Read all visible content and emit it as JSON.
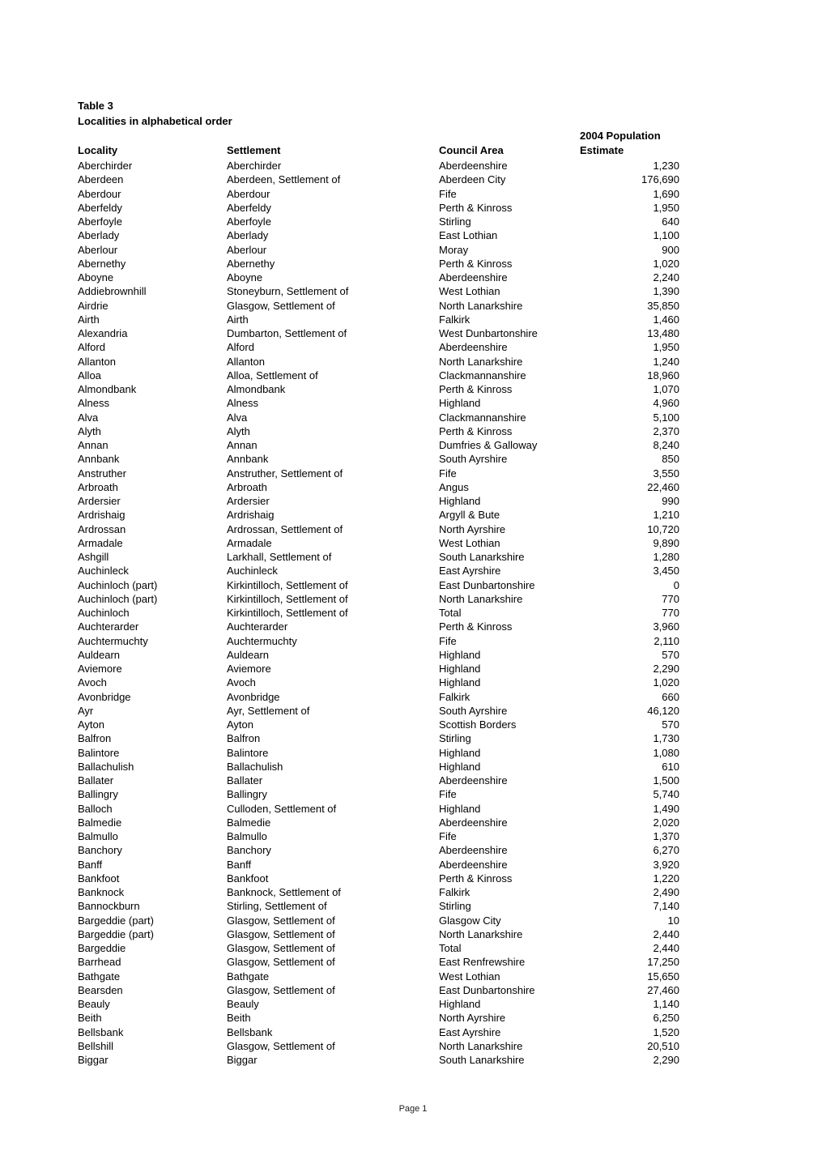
{
  "document": {
    "title": "Table 3",
    "subtitle": "Localities in alphabetical order",
    "columns": {
      "locality": "Locality",
      "settlement": "Settlement",
      "council_area": "Council Area",
      "population_line1": "2004 Population",
      "population_line2": "Estimate"
    },
    "rows": [
      [
        "Aberchirder",
        "Aberchirder",
        "Aberdeenshire",
        "1,230"
      ],
      [
        "Aberdeen",
        "Aberdeen, Settlement of",
        "Aberdeen City",
        "176,690"
      ],
      [
        "Aberdour",
        "Aberdour",
        "Fife",
        "1,690"
      ],
      [
        "Aberfeldy",
        "Aberfeldy",
        "Perth & Kinross",
        "1,950"
      ],
      [
        "Aberfoyle",
        "Aberfoyle",
        "Stirling",
        "640"
      ],
      [
        "Aberlady",
        "Aberlady",
        "East Lothian",
        "1,100"
      ],
      [
        "Aberlour",
        "Aberlour",
        "Moray",
        "900"
      ],
      [
        "Abernethy",
        "Abernethy",
        "Perth & Kinross",
        "1,020"
      ],
      [
        "Aboyne",
        "Aboyne",
        "Aberdeenshire",
        "2,240"
      ],
      [
        "Addiebrownhill",
        "Stoneyburn, Settlement of",
        "West Lothian",
        "1,390"
      ],
      [
        "Airdrie",
        "Glasgow, Settlement of",
        "North Lanarkshire",
        "35,850"
      ],
      [
        "Airth",
        "Airth",
        "Falkirk",
        "1,460"
      ],
      [
        "Alexandria",
        "Dumbarton, Settlement of",
        "West Dunbartonshire",
        "13,480"
      ],
      [
        "Alford",
        "Alford",
        "Aberdeenshire",
        "1,950"
      ],
      [
        "Allanton",
        "Allanton",
        "North Lanarkshire",
        "1,240"
      ],
      [
        "Alloa",
        "Alloa, Settlement of",
        "Clackmannanshire",
        "18,960"
      ],
      [
        "Almondbank",
        "Almondbank",
        "Perth & Kinross",
        "1,070"
      ],
      [
        "Alness",
        "Alness",
        "Highland",
        "4,960"
      ],
      [
        "Alva",
        "Alva",
        "Clackmannanshire",
        "5,100"
      ],
      [
        "Alyth",
        "Alyth",
        "Perth & Kinross",
        "2,370"
      ],
      [
        "Annan",
        "Annan",
        "Dumfries & Galloway",
        "8,240"
      ],
      [
        "Annbank",
        "Annbank",
        "South Ayrshire",
        "850"
      ],
      [
        "Anstruther",
        "Anstruther, Settlement of",
        "Fife",
        "3,550"
      ],
      [
        "Arbroath",
        "Arbroath",
        "Angus",
        "22,460"
      ],
      [
        "Ardersier",
        "Ardersier",
        "Highland",
        "990"
      ],
      [
        "Ardrishaig",
        "Ardrishaig",
        "Argyll & Bute",
        "1,210"
      ],
      [
        "Ardrossan",
        "Ardrossan, Settlement of",
        "North Ayrshire",
        "10,720"
      ],
      [
        "Armadale",
        "Armadale",
        "West Lothian",
        "9,890"
      ],
      [
        "Ashgill",
        "Larkhall, Settlement of",
        "South Lanarkshire",
        "1,280"
      ],
      [
        "Auchinleck",
        "Auchinleck",
        "East Ayrshire",
        "3,450"
      ],
      [
        "Auchinloch (part)",
        "Kirkintilloch, Settlement of",
        "East Dunbartonshire",
        "0"
      ],
      [
        "Auchinloch (part)",
        "Kirkintilloch, Settlement of",
        "North Lanarkshire",
        "770"
      ],
      [
        "Auchinloch",
        "Kirkintilloch, Settlement of",
        "Total",
        "770"
      ],
      [
        "Auchterarder",
        "Auchterarder",
        "Perth & Kinross",
        "3,960"
      ],
      [
        "Auchtermuchty",
        "Auchtermuchty",
        "Fife",
        "2,110"
      ],
      [
        "Auldearn",
        "Auldearn",
        "Highland",
        "570"
      ],
      [
        "Aviemore",
        "Aviemore",
        "Highland",
        "2,290"
      ],
      [
        "Avoch",
        "Avoch",
        "Highland",
        "1,020"
      ],
      [
        "Avonbridge",
        "Avonbridge",
        "Falkirk",
        "660"
      ],
      [
        "Ayr",
        "Ayr, Settlement of",
        "South Ayrshire",
        "46,120"
      ],
      [
        "Ayton",
        "Ayton",
        "Scottish Borders",
        "570"
      ],
      [
        "Balfron",
        "Balfron",
        "Stirling",
        "1,730"
      ],
      [
        "Balintore",
        "Balintore",
        "Highland",
        "1,080"
      ],
      [
        "Ballachulish",
        "Ballachulish",
        "Highland",
        "610"
      ],
      [
        "Ballater",
        "Ballater",
        "Aberdeenshire",
        "1,500"
      ],
      [
        "Ballingry",
        "Ballingry",
        "Fife",
        "5,740"
      ],
      [
        "Balloch",
        "Culloden, Settlement of",
        "Highland",
        "1,490"
      ],
      [
        "Balmedie",
        "Balmedie",
        "Aberdeenshire",
        "2,020"
      ],
      [
        "Balmullo",
        "Balmullo",
        "Fife",
        "1,370"
      ],
      [
        "Banchory",
        "Banchory",
        "Aberdeenshire",
        "6,270"
      ],
      [
        "Banff",
        "Banff",
        "Aberdeenshire",
        "3,920"
      ],
      [
        "Bankfoot",
        "Bankfoot",
        "Perth & Kinross",
        "1,220"
      ],
      [
        "Banknock",
        "Banknock, Settlement of",
        "Falkirk",
        "2,490"
      ],
      [
        "Bannockburn",
        "Stirling, Settlement of",
        "Stirling",
        "7,140"
      ],
      [
        "Bargeddie (part)",
        "Glasgow, Settlement of",
        "Glasgow City",
        "10"
      ],
      [
        "Bargeddie (part)",
        "Glasgow, Settlement of",
        "North Lanarkshire",
        "2,440"
      ],
      [
        "Bargeddie",
        "Glasgow, Settlement of",
        "Total",
        "2,440"
      ],
      [
        "Barrhead",
        "Glasgow, Settlement of",
        "East Renfrewshire",
        "17,250"
      ],
      [
        "Bathgate",
        "Bathgate",
        "West Lothian",
        "15,650"
      ],
      [
        "Bearsden",
        "Glasgow, Settlement of",
        "East Dunbartonshire",
        "27,460"
      ],
      [
        "Beauly",
        "Beauly",
        "Highland",
        "1,140"
      ],
      [
        "Beith",
        "Beith",
        "North Ayrshire",
        "6,250"
      ],
      [
        "Bellsbank",
        "Bellsbank",
        "East Ayrshire",
        "1,520"
      ],
      [
        "Bellshill",
        "Glasgow, Settlement of",
        "North Lanarkshire",
        "20,510"
      ],
      [
        "Biggar",
        "Biggar",
        "South Lanarkshire",
        "2,290"
      ]
    ],
    "footer": "Page 1"
  }
}
